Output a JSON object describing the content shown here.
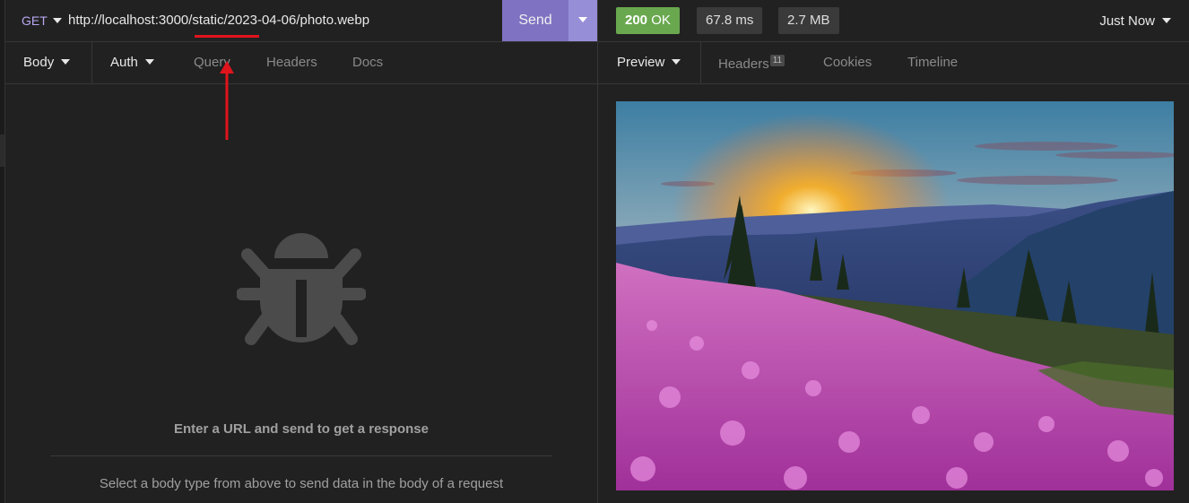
{
  "request": {
    "method": "GET",
    "url": "http://localhost:3000/static/2023-04-06/photo.webp",
    "send_label": "Send",
    "tabs": [
      {
        "label": "Body"
      },
      {
        "label": "Auth"
      },
      {
        "label": "Query"
      },
      {
        "label": "Headers"
      },
      {
        "label": "Docs"
      }
    ],
    "empty_title": "Enter a URL and send to get a response",
    "empty_hint": "Select a body type from above to send data in the body of a request"
  },
  "response": {
    "status_code": "200",
    "status_text": "OK",
    "time": "67.8 ms",
    "size": "2.7 MB",
    "history": "Just Now",
    "tabs": [
      {
        "label": "Preview"
      },
      {
        "label": "Headers",
        "badge": "11"
      },
      {
        "label": "Cookies"
      },
      {
        "label": "Timeline"
      }
    ]
  },
  "colors": {
    "accent": "#7f72c2",
    "ok": "#6aa84f",
    "annotation": "#e0141c"
  },
  "icons": [
    "bug-icon",
    "caret-down-icon",
    "arrow-up-icon"
  ]
}
